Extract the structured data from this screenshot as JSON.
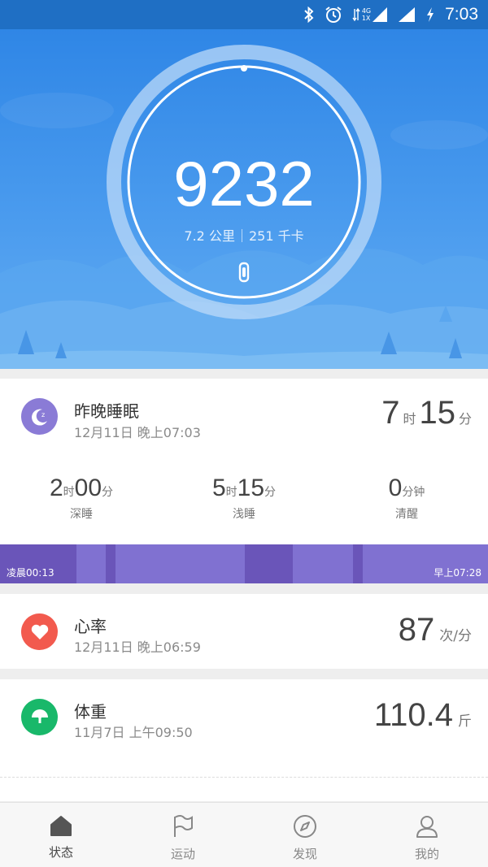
{
  "status_bar": {
    "time": "7:03",
    "network_top": "4G",
    "network_bottom": "1X"
  },
  "hero": {
    "steps": "9232",
    "distance": "7.2 公里",
    "calories": "251 千卡"
  },
  "sleep": {
    "title": "昨晚睡眠",
    "timestamp": "12月11日 晚上07:03",
    "total_hours": "7",
    "hour_unit": "时",
    "total_minutes": "15",
    "minute_unit": "分",
    "deep": {
      "hours": "2",
      "hour_unit": "时",
      "minutes": "00",
      "minute_unit": "分",
      "label": "深睡"
    },
    "light": {
      "hours": "5",
      "hour_unit": "时",
      "minutes": "15",
      "minute_unit": "分",
      "label": "浅睡"
    },
    "awake": {
      "minutes": "0",
      "unit": "分钟",
      "label": "清醒"
    },
    "start_label": "凌晨00:13",
    "end_label": "早上07:28"
  },
  "heart_rate": {
    "title": "心率",
    "timestamp": "12月11日 晚上06:59",
    "value": "87",
    "unit": "次/分"
  },
  "weight": {
    "title": "体重",
    "timestamp": "11月7日 上午09:50",
    "value": "110.4",
    "unit": "斤"
  },
  "bottom_nav": {
    "items": [
      {
        "label": "状态"
      },
      {
        "label": "运动"
      },
      {
        "label": "发现"
      },
      {
        "label": "我的"
      }
    ]
  },
  "colors": {
    "hero_blue": "#2f86e6",
    "sleep_purple": "#8071d1",
    "heart_red": "#f25a4e",
    "weight_green": "#19b86a"
  }
}
